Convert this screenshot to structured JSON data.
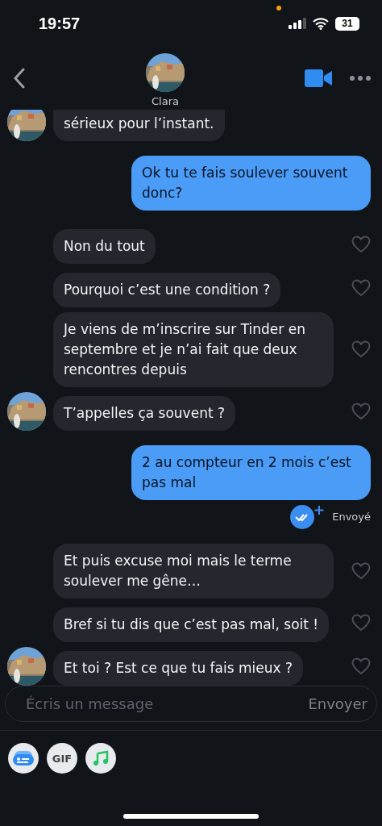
{
  "status_bar": {
    "time": "19:57",
    "battery": "31"
  },
  "header": {
    "contact_name": "Clara"
  },
  "messages": [
    {
      "kind": "received",
      "text": "sérieux pour l’instant.",
      "avatar": true,
      "cut": true
    },
    {
      "kind": "sent",
      "text": "Ok tu te fais soulever souvent donc?"
    },
    {
      "kind": "received",
      "text": "Non du tout",
      "avatar": false,
      "liked": false
    },
    {
      "kind": "received",
      "text": "Pourquoi c’est une condition ?",
      "avatar": false,
      "liked": false
    },
    {
      "kind": "received",
      "text": "Je viens de m’inscrire sur Tinder en septembre et je n’ai fait que deux rencontres depuis",
      "avatar": false,
      "liked": false
    },
    {
      "kind": "received",
      "text": "T’appelles ça souvent ?",
      "avatar": true,
      "liked": false
    },
    {
      "kind": "sent",
      "text": "2 au compteur en 2 mois c’est pas mal"
    },
    {
      "kind": "status",
      "text": "Envoyé"
    },
    {
      "kind": "received",
      "text": "Et puis excuse moi mais le terme soulever me gêne…",
      "avatar": false,
      "liked": false
    },
    {
      "kind": "received",
      "text": "Bref si tu dis que c’est pas mal, soit !",
      "avatar": false,
      "liked": false
    },
    {
      "kind": "received",
      "text": "Et toi ? Est ce que tu fais mieux ?",
      "avatar": true,
      "liked": false
    }
  ],
  "composer": {
    "placeholder": "Écris un message",
    "send_label": "Envoyer"
  },
  "attachments": [
    {
      "kind": "card"
    },
    {
      "kind": "gif",
      "label": "GIF"
    },
    {
      "kind": "music"
    }
  ]
}
